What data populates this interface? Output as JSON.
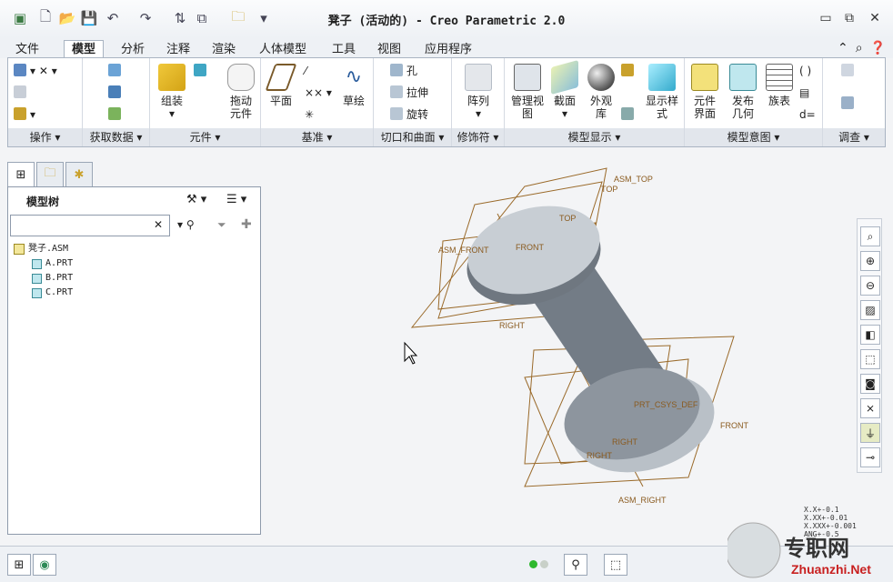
{
  "window": {
    "title": "凳子 (活动的) - Creo Parametric 2.0",
    "minimize": "▭",
    "restore": "⧉",
    "close": "✕"
  },
  "qat": {
    "items": [
      "new-icon",
      "open-icon",
      "save-icon",
      "undo-icon",
      "redo-icon",
      "regenerate-icon",
      "windows-icon",
      "close-window-icon",
      "customize-icon"
    ]
  },
  "menu": {
    "tabs": [
      "文件",
      "模型",
      "分析",
      "注释",
      "渲染",
      "人体模型",
      "工具",
      "视图",
      "应用程序"
    ],
    "active": "模型"
  },
  "ribbon": {
    "groups": [
      "操作 ▾",
      "获取数据 ▾",
      "元件 ▾",
      "基准 ▾",
      "切口和曲面 ▾",
      "修饰符 ▾",
      "模型显示 ▾",
      "模型意图 ▾",
      "调查 ▾"
    ],
    "assemble": "组装",
    "drag": "拖动\n元件",
    "plane": "平面",
    "sketch": "草绘",
    "hole": "孔",
    "extrude": "拉伸",
    "revolve": "旋转",
    "pattern": "阵列",
    "manage_views": "管理视\n图",
    "section": "截面",
    "appearance": "外观\n库",
    "display_style": "显示样\n式",
    "component_interface": "元件\n界面",
    "publish_geom": "发布\n几何",
    "family_table": "族表"
  },
  "model_tree": {
    "title": "模型树",
    "items": [
      "凳子.ASM",
      "A.PRT",
      "B.PRT",
      "C.PRT"
    ],
    "filter_placeholder": ""
  },
  "viewport": {
    "labels": [
      "ASM_TOP",
      "TOP",
      "TOP",
      "ASM_FRONT",
      "FRONT",
      "RIGHT",
      "PRT_CSYS_DEF",
      "FRONT",
      "RIGHT",
      "RIGHT",
      "ASM_RIGHT"
    ]
  },
  "tolerance": [
    "X.X+-0.1",
    "X.XX+-0.01",
    "X.XXX+-0.001",
    "ANG+-0.5"
  ],
  "watermark": {
    "cn": "专职网",
    "url": "Zhuanzhi.Net"
  },
  "colors": {
    "accent": "#4e6b8f",
    "datum": "#9a6a2a",
    "part": "#7b848e"
  }
}
